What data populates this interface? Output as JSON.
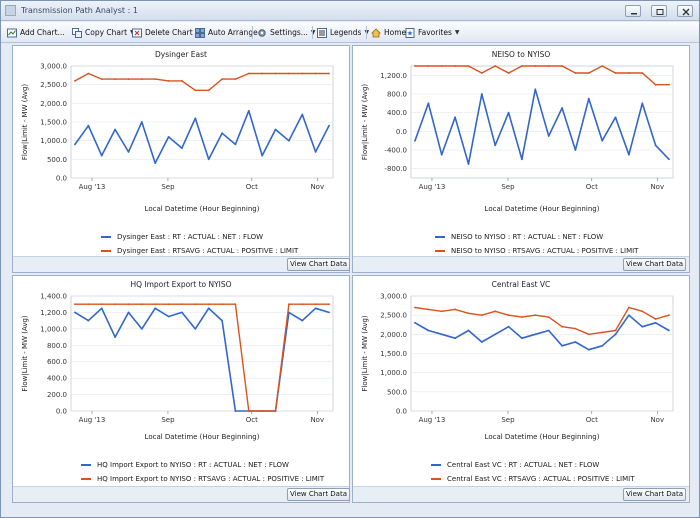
{
  "window": {
    "title": "Transmission Path Analyst : 1"
  },
  "toolbar": {
    "add_chart": "Add Chart...",
    "copy_chart": "Copy Chart",
    "delete_chart": "Delete Chart",
    "auto_arrange": "Auto Arrange",
    "settings": "Settings...",
    "legends": "Legends",
    "home": "Home",
    "favorites": "Favorites"
  },
  "view_chart_data_label": "View Chart Data",
  "colors": {
    "flow": "#3366cc",
    "limit": "#d9531e"
  },
  "chart_data": [
    {
      "title": "Dysinger East",
      "type": "line",
      "xlabel": "Local Datetime (Hour Beginning)",
      "ylabel": "Flow|Limit - MW (Avg)",
      "x_ticks": [
        "Aug '13",
        "Sep",
        "Oct",
        "Nov"
      ],
      "y_ticks": [
        "3,000.0",
        "2,500.0",
        "2,000.0",
        "1,500.0",
        "1,000.0",
        "500.0",
        "0.0"
      ],
      "ylim": [
        0,
        3000
      ],
      "legend": [
        "Dysinger East : RT : ACTUAL : NET : FLOW",
        "Dysinger East : RTSAVG : ACTUAL : POSITIVE : LIMIT"
      ],
      "series": [
        {
          "name": "Dysinger East : RT : ACTUAL : NET : FLOW",
          "values": [
            900,
            1400,
            600,
            1300,
            700,
            1500,
            400,
            1100,
            800,
            1600,
            500,
            1200,
            900,
            1800,
            600,
            1300,
            1000,
            1700,
            700,
            1400
          ]
        },
        {
          "name": "Dysinger East : RTSAVG : ACTUAL : POSITIVE : LIMIT",
          "values": [
            2600,
            2800,
            2650,
            2650,
            2650,
            2650,
            2650,
            2600,
            2600,
            2350,
            2350,
            2650,
            2650,
            2800,
            2800,
            2800,
            2800,
            2800,
            2800,
            2800
          ]
        }
      ]
    },
    {
      "title": "NEISO to NYISO",
      "type": "line",
      "xlabel": "Local Datetime (Hour Beginning)",
      "ylabel": "Flow|Limit - MW (Avg)",
      "x_ticks": [
        "Aug '13",
        "Sep",
        "Oct",
        "Nov"
      ],
      "y_ticks": [
        "1,200.0",
        "800.0",
        "400.0",
        "0.0",
        "-400.0",
        "-800.0"
      ],
      "ylim": [
        -1000,
        1400
      ],
      "legend": [
        "NEISO to NYISO : RT : ACTUAL : NET : FLOW",
        "NEISO to NYISO : RTSAVG : ACTUAL : POSITIVE : LIMIT"
      ],
      "series": [
        {
          "name": "NEISO to NYISO : RT : ACTUAL : NET : FLOW",
          "values": [
            -200,
            600,
            -500,
            300,
            -700,
            800,
            -300,
            400,
            -600,
            900,
            -100,
            500,
            -400,
            700,
            -200,
            300,
            -500,
            600,
            -300,
            -600
          ]
        },
        {
          "name": "NEISO to NYISO : RTSAVG : ACTUAL : POSITIVE : LIMIT",
          "values": [
            1400,
            1400,
            1400,
            1400,
            1400,
            1250,
            1400,
            1250,
            1400,
            1400,
            1400,
            1400,
            1250,
            1250,
            1400,
            1250,
            1250,
            1250,
            1000,
            1000
          ]
        }
      ]
    },
    {
      "title": "HQ Import Export to NYISO",
      "type": "line",
      "xlabel": "Local Datetime (Hour Beginning)",
      "ylabel": "Flow|Limit - MW (Avg)",
      "x_ticks": [
        "Aug '13",
        "Sep",
        "Oct",
        "Nov"
      ],
      "y_ticks": [
        "1,400.0",
        "1,200.0",
        "1,000.0",
        "800.0",
        "600.0",
        "400.0",
        "200.0",
        "0.0"
      ],
      "ylim": [
        0,
        1400
      ],
      "legend": [
        "HQ Import Export to NYISO : RT : ACTUAL : NET : FLOW",
        "HQ Import Export to NYISO : RTSAVG : ACTUAL : POSITIVE : LIMIT"
      ],
      "series": [
        {
          "name": "HQ Import Export to NYISO : RT : ACTUAL : NET : FLOW",
          "values": [
            1200,
            1100,
            1250,
            900,
            1200,
            1000,
            1250,
            1150,
            1200,
            1000,
            1250,
            1100,
            0,
            0,
            0,
            0,
            1200,
            1100,
            1250,
            1200
          ]
        },
        {
          "name": "HQ Import Export to NYISO : RTSAVG : ACTUAL : POSITIVE : LIMIT",
          "values": [
            1300,
            1300,
            1300,
            1300,
            1300,
            1300,
            1300,
            1300,
            1300,
            1300,
            1300,
            1300,
            1300,
            0,
            0,
            0,
            1300,
            1300,
            1300,
            1300
          ]
        }
      ]
    },
    {
      "title": "Central East VC",
      "type": "line",
      "xlabel": "Local Datetime (Hour Beginning)",
      "ylabel": "Flow|Limit - MW (Avg)",
      "x_ticks": [
        "Aug '13",
        "Sep",
        "Oct",
        "Nov"
      ],
      "y_ticks": [
        "3,000.0",
        "2,500.0",
        "2,000.0",
        "1,500.0",
        "1,000.0",
        "500.0",
        "0.0"
      ],
      "ylim": [
        0,
        3000
      ],
      "legend": [
        "Central East VC : RT : ACTUAL : NET : FLOW",
        "Central East VC : RTSAVG : ACTUAL : POSITIVE : LIMIT"
      ],
      "series": [
        {
          "name": "Central East VC : RT : ACTUAL : NET : FLOW",
          "values": [
            2300,
            2100,
            2000,
            1900,
            2100,
            1800,
            2000,
            2200,
            1900,
            2000,
            2100,
            1700,
            1800,
            1600,
            1700,
            2000,
            2500,
            2200,
            2300,
            2100
          ]
        },
        {
          "name": "Central East VC : RTSAVG : ACTUAL : POSITIVE : LIMIT",
          "values": [
            2700,
            2650,
            2600,
            2650,
            2550,
            2500,
            2600,
            2500,
            2450,
            2500,
            2450,
            2200,
            2150,
            2000,
            2050,
            2100,
            2700,
            2600,
            2400,
            2500
          ]
        }
      ]
    }
  ]
}
